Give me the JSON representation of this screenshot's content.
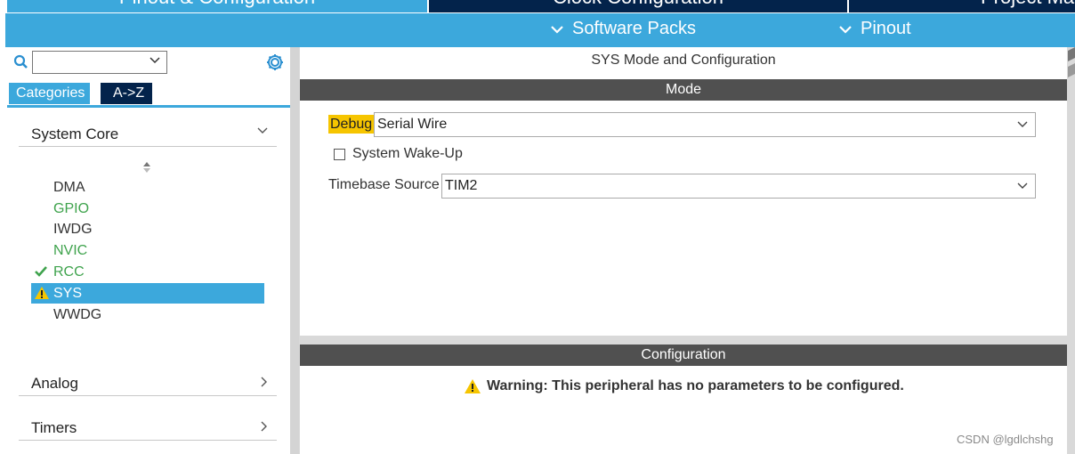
{
  "tabs": {
    "pinout_config": "Pinout & Configuration",
    "clock_config": "Clock Configuration",
    "project_manager": "Project Ma"
  },
  "menu": {
    "software_packs": "Software Packs",
    "pinout": "Pinout"
  },
  "sidebar": {
    "search": {
      "value": ""
    },
    "view_tabs": {
      "categories": "Categories",
      "az": "A->Z"
    },
    "sections": {
      "system_core": "System Core",
      "analog": "Analog",
      "timers": "Timers"
    },
    "items": [
      {
        "label": "DMA",
        "status": "none"
      },
      {
        "label": "GPIO",
        "status": "green"
      },
      {
        "label": "IWDG",
        "status": "none"
      },
      {
        "label": "NVIC",
        "status": "green"
      },
      {
        "label": "RCC",
        "status": "ok"
      },
      {
        "label": "SYS",
        "status": "warning",
        "selected": true
      },
      {
        "label": "WWDG",
        "status": "none"
      }
    ]
  },
  "main": {
    "panel_title": "SYS Mode and Configuration",
    "mode_header": "Mode",
    "debug": {
      "label": "Debug",
      "value": "Serial Wire"
    },
    "wakeup": {
      "label": "System Wake-Up",
      "checked": false
    },
    "timebase": {
      "label": "Timebase Source",
      "value": "TIM2"
    },
    "config_header": "Configuration",
    "warning_text": "Warning: This peripheral has no parameters to be configured."
  },
  "watermark": "CSDN @lgdlchshg",
  "colors": {
    "accent_blue": "#3ca8dc",
    "navy": "#03234b",
    "green": "#3fa34d",
    "warning_yellow": "#f6c500",
    "bar_gray": "#505050"
  }
}
